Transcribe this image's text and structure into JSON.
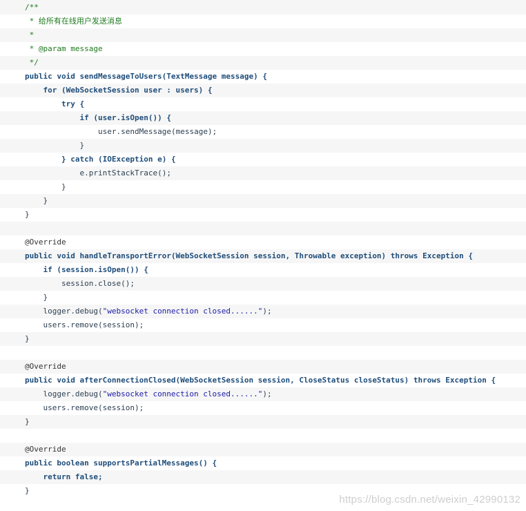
{
  "code_lines": [
    {
      "indent": 0,
      "segments": [
        {
          "cls": "comment",
          "text": "/**"
        }
      ]
    },
    {
      "indent": 0,
      "segments": [
        {
          "cls": "comment",
          "text": " * 给所有在线用户发送消息"
        }
      ]
    },
    {
      "indent": 0,
      "segments": [
        {
          "cls": "comment",
          "text": " *"
        }
      ]
    },
    {
      "indent": 0,
      "segments": [
        {
          "cls": "comment",
          "text": " * @param message"
        }
      ]
    },
    {
      "indent": 0,
      "segments": [
        {
          "cls": "comment",
          "text": " */"
        }
      ]
    },
    {
      "indent": 0,
      "segments": [
        {
          "cls": "kw",
          "text": "public void sendMessageToUsers(TextMessage message) {"
        }
      ]
    },
    {
      "indent": 1,
      "segments": [
        {
          "cls": "kw",
          "text": "for (WebSocketSession user : users) {"
        }
      ]
    },
    {
      "indent": 2,
      "segments": [
        {
          "cls": "kw",
          "text": "try {"
        }
      ]
    },
    {
      "indent": 3,
      "segments": [
        {
          "cls": "kw",
          "text": "if (user.isOpen()) {"
        }
      ]
    },
    {
      "indent": 4,
      "segments": [
        {
          "cls": "plain",
          "text": "user.sendMessage(message);"
        }
      ]
    },
    {
      "indent": 3,
      "segments": [
        {
          "cls": "plain",
          "text": "}"
        }
      ]
    },
    {
      "indent": 2,
      "segments": [
        {
          "cls": "kw",
          "text": "} catch (IOException e) {"
        }
      ]
    },
    {
      "indent": 3,
      "segments": [
        {
          "cls": "plain",
          "text": "e.printStackTrace();"
        }
      ]
    },
    {
      "indent": 2,
      "segments": [
        {
          "cls": "plain",
          "text": "}"
        }
      ]
    },
    {
      "indent": 1,
      "segments": [
        {
          "cls": "plain",
          "text": "}"
        }
      ]
    },
    {
      "indent": 0,
      "segments": [
        {
          "cls": "plain",
          "text": "}"
        }
      ]
    },
    {
      "indent": 0,
      "segments": []
    },
    {
      "indent": 0,
      "segments": [
        {
          "cls": "ann",
          "text": "@Override"
        }
      ]
    },
    {
      "indent": 0,
      "segments": [
        {
          "cls": "kw",
          "text": "public void handleTransportError(WebSocketSession session, Throwable exception) throws Exception {"
        }
      ]
    },
    {
      "indent": 1,
      "segments": [
        {
          "cls": "kw",
          "text": "if (session.isOpen()) {"
        }
      ]
    },
    {
      "indent": 2,
      "segments": [
        {
          "cls": "plain",
          "text": "session.close();"
        }
      ]
    },
    {
      "indent": 1,
      "segments": [
        {
          "cls": "plain",
          "text": "}"
        }
      ]
    },
    {
      "indent": 1,
      "segments": [
        {
          "cls": "plain",
          "text": "logger.debug("
        },
        {
          "cls": "str",
          "text": "\"websocket connection closed......\""
        },
        {
          "cls": "plain",
          "text": ");"
        }
      ]
    },
    {
      "indent": 1,
      "segments": [
        {
          "cls": "plain",
          "text": "users.remove(session);"
        }
      ]
    },
    {
      "indent": 0,
      "segments": [
        {
          "cls": "plain",
          "text": "}"
        }
      ]
    },
    {
      "indent": 0,
      "segments": []
    },
    {
      "indent": 0,
      "segments": [
        {
          "cls": "ann",
          "text": "@Override"
        }
      ]
    },
    {
      "indent": 0,
      "segments": [
        {
          "cls": "kw",
          "text": "public void afterConnectionClosed(WebSocketSession session, CloseStatus closeStatus) throws Exception {"
        }
      ]
    },
    {
      "indent": 1,
      "segments": [
        {
          "cls": "plain",
          "text": "logger.debug("
        },
        {
          "cls": "str",
          "text": "\"websocket connection closed......\""
        },
        {
          "cls": "plain",
          "text": ");"
        }
      ]
    },
    {
      "indent": 1,
      "segments": [
        {
          "cls": "plain",
          "text": "users.remove(session);"
        }
      ]
    },
    {
      "indent": 0,
      "segments": [
        {
          "cls": "plain",
          "text": "}"
        }
      ]
    },
    {
      "indent": 0,
      "segments": []
    },
    {
      "indent": 0,
      "segments": [
        {
          "cls": "ann",
          "text": "@Override"
        }
      ]
    },
    {
      "indent": 0,
      "segments": [
        {
          "cls": "kw",
          "text": "public boolean supportsPartialMessages() {"
        }
      ]
    },
    {
      "indent": 1,
      "segments": [
        {
          "cls": "kw",
          "text": "return false;"
        }
      ]
    },
    {
      "indent": 0,
      "segments": [
        {
          "cls": "plain",
          "text": "}"
        }
      ]
    }
  ],
  "watermark": "https://blog.csdn.net/weixin_42990132",
  "colors": {
    "comment": "#1f7a1f",
    "keyword": "#1f4d7a",
    "string": "#1a1aa6",
    "shade": "#f6f6f6"
  }
}
